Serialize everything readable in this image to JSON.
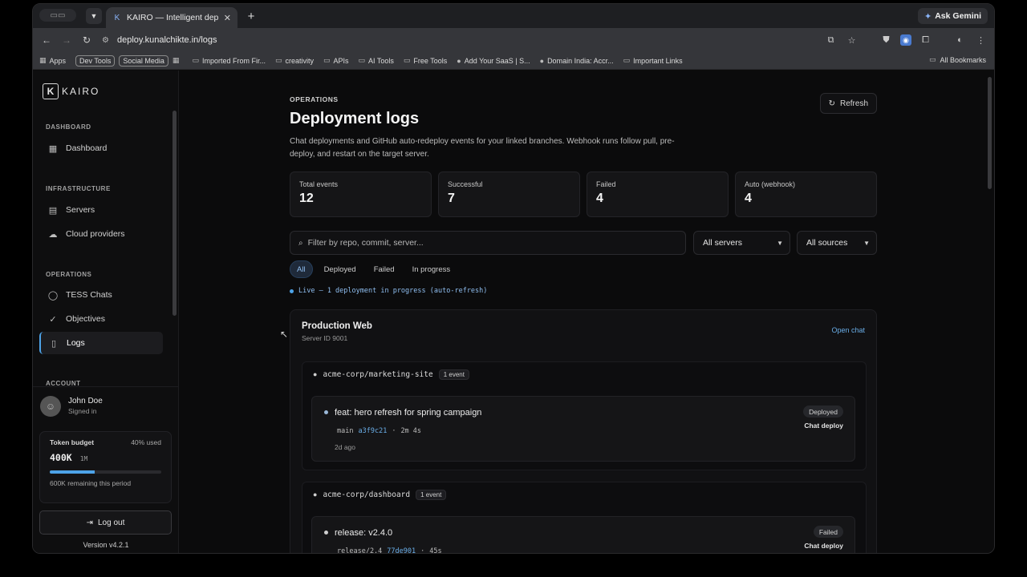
{
  "browser": {
    "tab_title": "KAIRO — Intelligent deployme",
    "url": "deploy.kunalchikte.in/logs",
    "ask_gemini": "Ask Gemini",
    "bookmarks": [
      {
        "label": "Apps",
        "icon": "grid-icon",
        "boxed": false
      },
      {
        "label": "Dev Tools",
        "icon": "",
        "boxed": true
      },
      {
        "label": "Social Media",
        "icon": "",
        "boxed": true
      },
      {
        "label": "",
        "icon": "grid-icon",
        "boxed": false
      },
      {
        "label": "Imported From Fir...",
        "icon": "folder-icon",
        "boxed": false
      },
      {
        "label": "creativity",
        "icon": "folder-icon",
        "boxed": false
      },
      {
        "label": "APIs",
        "icon": "folder-icon",
        "boxed": false
      },
      {
        "label": "AI Tools",
        "icon": "folder-icon",
        "boxed": false
      },
      {
        "label": "Free Tools",
        "icon": "folder-icon",
        "boxed": false
      },
      {
        "label": "Add Your SaaS | S...",
        "icon": "site-icon",
        "boxed": false
      },
      {
        "label": "Domain India: Accr...",
        "icon": "site-icon",
        "boxed": false
      },
      {
        "label": "Important Links",
        "icon": "folder-icon",
        "boxed": false
      }
    ],
    "all_bookmarks": "All Bookmarks"
  },
  "sidebar": {
    "logo": "KAIRO",
    "sections": {
      "dashboard": "DASHBOARD",
      "infrastructure": "INFRASTRUCTURE",
      "operations": "OPERATIONS",
      "account": "ACCOUNT"
    },
    "items": {
      "dashboard": "Dashboard",
      "servers": "Servers",
      "cloud_providers": "Cloud providers",
      "tess_chats": "TESS Chats",
      "objectives": "Objectives",
      "logs": "Logs"
    },
    "user": {
      "name": "John Doe",
      "status": "Signed in"
    },
    "budget": {
      "label": "Token budget",
      "pct_used": "40% used",
      "used": "400K",
      "total": "1M",
      "fraction": 0.4,
      "remaining": "600K remaining this period"
    },
    "logout": "Log out",
    "version": "Version v4.2.1"
  },
  "main": {
    "eyebrow": "OPERATIONS",
    "title": "Deployment logs",
    "description": "Chat deployments and GitHub auto-redeploy events for your linked branches. Webhook runs follow pull, pre-deploy, and restart on the target server.",
    "refresh": "Refresh",
    "stats": [
      {
        "label": "Total events",
        "value": "12"
      },
      {
        "label": "Successful",
        "value": "7"
      },
      {
        "label": "Failed",
        "value": "4"
      },
      {
        "label": "Auto (webhook)",
        "value": "4"
      }
    ],
    "search_placeholder": "Filter by repo, commit, server...",
    "server_filter": "All servers",
    "source_filter": "All sources",
    "filters": [
      "All",
      "Deployed",
      "Failed",
      "In progress"
    ],
    "live": "Live — 1 deployment in progress (auto-refresh)",
    "server": {
      "name": "Production Web",
      "id": "Server ID 9001",
      "open_chat": "Open chat",
      "repos": [
        {
          "name": "acme-corp/marketing-site",
          "count": "1 event",
          "event": {
            "title": "feat: hero refresh for spring campaign",
            "branch": "main",
            "sha": "a3f9c21",
            "duration": "2m 4s",
            "time": "2d ago",
            "status": "Deployed",
            "source": "Chat deploy"
          }
        },
        {
          "name": "acme-corp/dashboard",
          "count": "1 event",
          "event": {
            "title": "release: v2.4.0",
            "branch": "release/2.4",
            "sha": "77de901",
            "duration": "45s",
            "time": "",
            "status": "Failed",
            "source": "Chat deploy"
          }
        }
      ]
    }
  },
  "colors": {
    "accent": "#4da3e8",
    "link": "#6aaee8",
    "background": "#0b0b0c"
  }
}
